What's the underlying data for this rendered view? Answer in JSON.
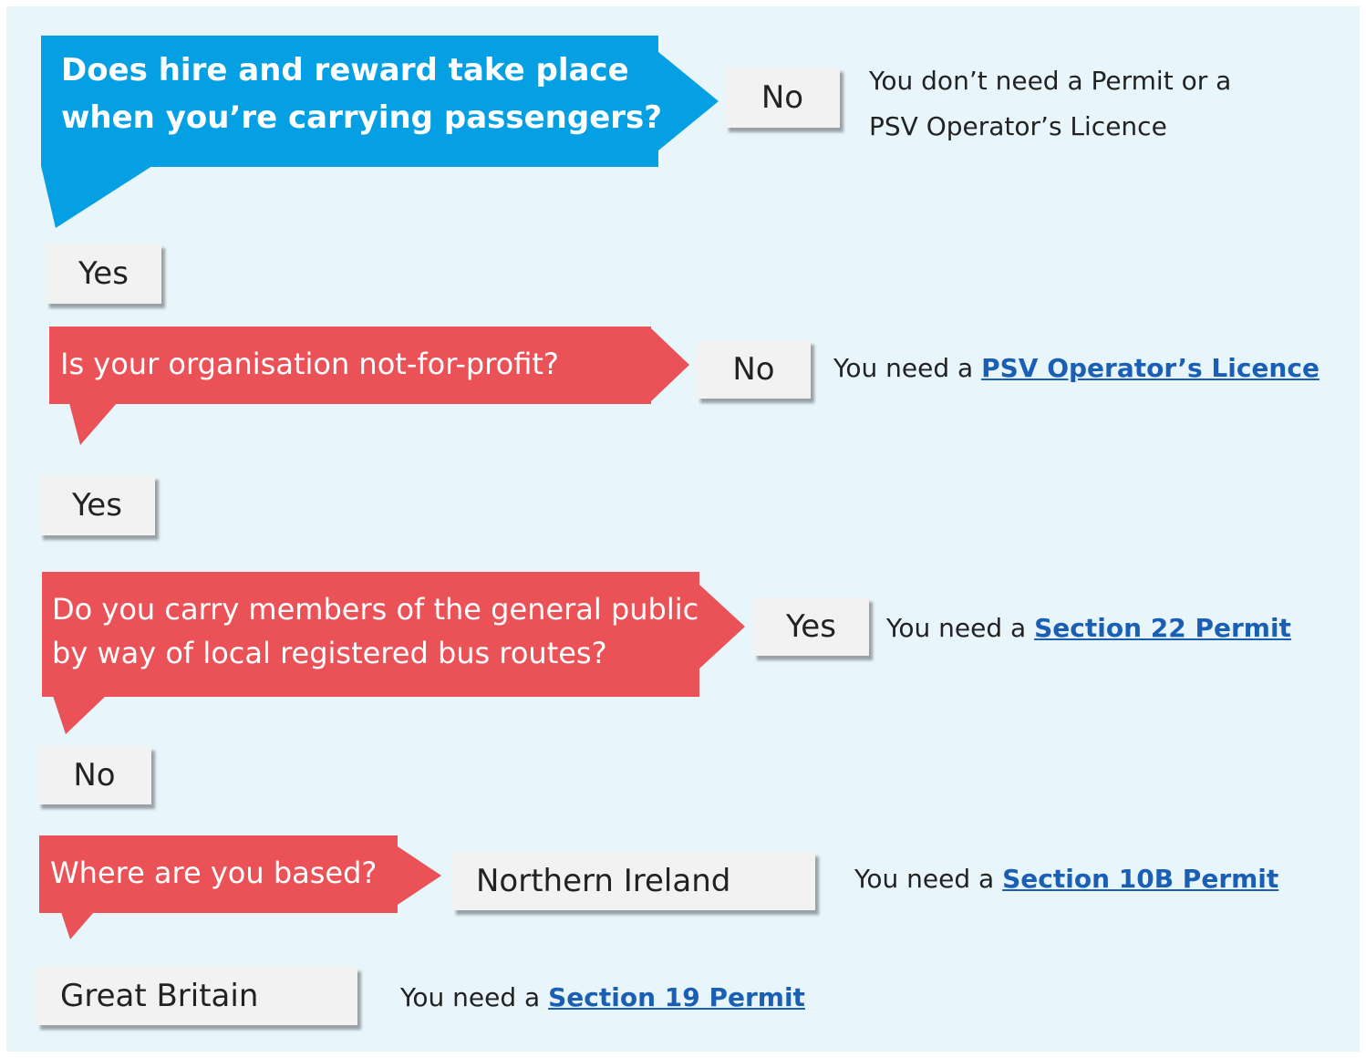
{
  "colors": {
    "background": "#e8f6fc",
    "blue_question": "#05a0e3",
    "red_question": "#ea5257",
    "answer_box": "#f2f2f2",
    "link": "#1a5fb4"
  },
  "q1": {
    "line1": "Does hire and reward take place",
    "line2": "when you’re carrying passengers?",
    "no_label": "No",
    "no_result_line1": "You don’t need a Permit or a",
    "no_result_line2": "PSV Operator’s Licence",
    "yes_label": "Yes"
  },
  "q2": {
    "text": "Is your organisation not-for-profit?",
    "no_label": "No",
    "no_result_prefix": "You need a ",
    "no_result_link": "PSV Operator’s Licence",
    "yes_label": "Yes"
  },
  "q3": {
    "line1": "Do you carry members of the general public",
    "line2": "by way of local registered bus routes?",
    "yes_label": "Yes",
    "yes_result_prefix": "You need a ",
    "yes_result_link": "Section 22 Permit",
    "no_label": "No"
  },
  "q4": {
    "text": "Where are you based?",
    "ni_label": "Northern Ireland",
    "ni_result_prefix": "You need a ",
    "ni_result_link": "Section 10B Permit",
    "gb_label": "Great Britain",
    "gb_result_prefix": "You need a ",
    "gb_result_link": "Section 19 Permit"
  }
}
